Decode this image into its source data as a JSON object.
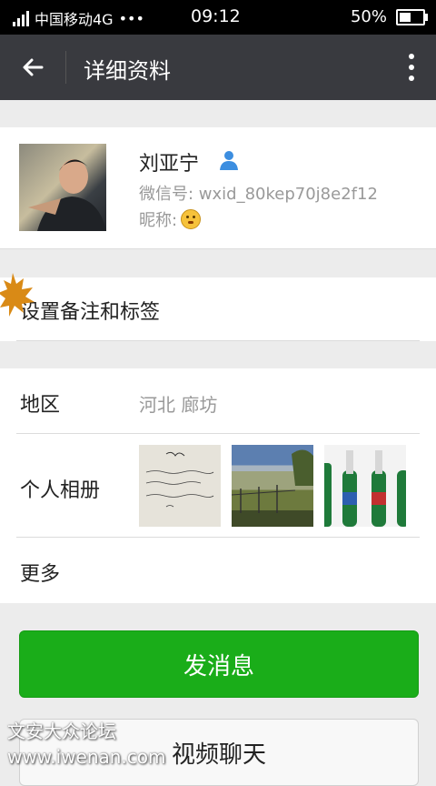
{
  "status_bar": {
    "carrier": "中国移动4G",
    "carrier_extra": "•••",
    "network_badge": "4G",
    "time": "09:12",
    "battery": "50%",
    "battery_level": 0.5
  },
  "app_bar": {
    "title": "详细资料",
    "back_icon": "arrow-left-icon",
    "more_icon": "more-vertical-icon"
  },
  "profile": {
    "name": "刘亚宁",
    "wechat_id": "微信号: wxid_80kep70j8e2f12",
    "nickname_label": "昵称:",
    "verified_icon": "person-icon",
    "nickname_icon": "emoji-face-icon"
  },
  "remark": {
    "label": "设置备注和标签"
  },
  "info_rows": {
    "region_label": "地区",
    "region_value": "河北  廊坊",
    "album_label": "个人相册",
    "more_label": "更多"
  },
  "buttons": {
    "send_message": "发消息",
    "video_chat": "视频聊天"
  },
  "watermark": {
    "line1": "文安大众论坛",
    "line2": "www.iwenan.com"
  },
  "colors": {
    "app_bar": "#393a3f",
    "primary_green": "#1aad19",
    "background": "#ececec"
  }
}
